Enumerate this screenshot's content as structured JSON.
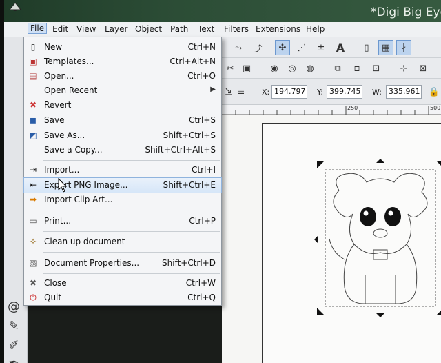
{
  "window": {
    "title": "*Digi Big Eye"
  },
  "menubar": {
    "items": [
      "File",
      "Edit",
      "View",
      "Layer",
      "Object",
      "Path",
      "Text",
      "Filters",
      "Extensions",
      "Help"
    ]
  },
  "file_menu": {
    "items": [
      {
        "label": "New",
        "shortcut": "Ctrl+N",
        "icon": "new-document-icon"
      },
      {
        "label": "Templates...",
        "shortcut": "Ctrl+Alt+N",
        "icon": "templates-icon"
      },
      {
        "label": "Open...",
        "shortcut": "Ctrl+O",
        "icon": "open-folder-icon"
      },
      {
        "label": "Open Recent",
        "shortcut": "",
        "icon": ""
      },
      {
        "label": "Revert",
        "shortcut": "",
        "icon": "revert-icon"
      },
      {
        "label": "Save",
        "shortcut": "Ctrl+S",
        "icon": "save-icon"
      },
      {
        "label": "Save As...",
        "shortcut": "Shift+Ctrl+S",
        "icon": "save-as-icon"
      },
      {
        "label": "Save a Copy...",
        "shortcut": "Shift+Ctrl+Alt+S",
        "icon": ""
      },
      {
        "label": "Import...",
        "shortcut": "Ctrl+I",
        "icon": "import-icon"
      },
      {
        "label": "Export PNG Image...",
        "shortcut": "Shift+Ctrl+E",
        "icon": "export-png-icon"
      },
      {
        "label": "Import Clip Art...",
        "shortcut": "",
        "icon": "clip-art-icon"
      },
      {
        "label": "Print...",
        "shortcut": "Ctrl+P",
        "icon": "print-icon"
      },
      {
        "label": "Clean up document",
        "shortcut": "",
        "icon": "broom-icon"
      },
      {
        "label": "Document Properties...",
        "shortcut": "Shift+Ctrl+D",
        "icon": "document-properties-icon"
      },
      {
        "label": "Close",
        "shortcut": "Ctrl+W",
        "icon": "close-icon"
      },
      {
        "label": "Quit",
        "shortcut": "Ctrl+Q",
        "icon": "quit-icon"
      }
    ],
    "highlighted": "Export PNG Image..."
  },
  "coords": {
    "x_label": "X:",
    "x_value": "194.797",
    "y_label": "Y:",
    "y_value": "399.745",
    "w_label": "W:",
    "w_value": "335.961"
  },
  "ruler": {
    "labels": [
      "250",
      "500"
    ]
  },
  "colors": {
    "menu_highlight": "#d6e6f8",
    "toolbar_selected": "#bcd3ee",
    "titlebar": "#2c4d36"
  }
}
